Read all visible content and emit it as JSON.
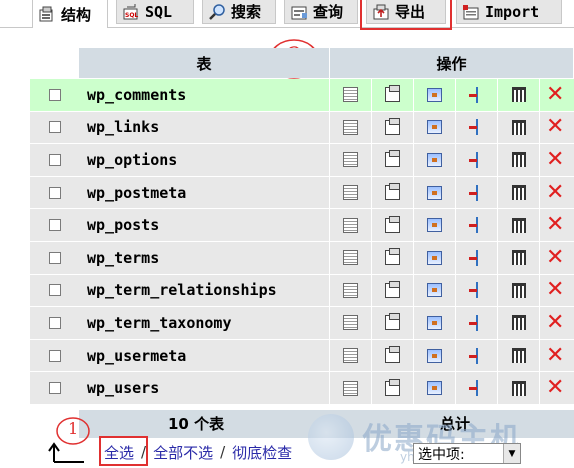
{
  "tabs": [
    {
      "label": "结构",
      "icon": "structure-icon",
      "active": true
    },
    {
      "label": "SQL",
      "icon": "sql-icon"
    },
    {
      "label": "搜索",
      "icon": "search-icon"
    },
    {
      "label": "查询",
      "icon": "query-icon"
    },
    {
      "label": "导出",
      "icon": "export-icon"
    },
    {
      "label": "Import",
      "icon": "import-icon"
    }
  ],
  "header": {
    "table_col": "表",
    "actions_col": "操作"
  },
  "annotations": {
    "circle_2": "2",
    "circle_1": "1"
  },
  "tables": [
    "wp_comments",
    "wp_links",
    "wp_options",
    "wp_postmeta",
    "wp_posts",
    "wp_terms",
    "wp_term_relationships",
    "wp_term_taxonomy",
    "wp_usermeta",
    "wp_users"
  ],
  "row_actions": [
    "browse-icon",
    "structure-icon",
    "search-icon",
    "insert-icon",
    "empty-icon",
    "drop-icon"
  ],
  "footer": {
    "count": "10 个表",
    "total": "总计",
    "select_all": "全选",
    "unselect_all": "全部不选",
    "check_overhead": "彻底检查",
    "with_selected": "选中项:",
    "separator": "/"
  },
  "watermark": {
    "text": "优惠码主机",
    "sub": "yhm....com"
  },
  "colors": {
    "header": "#d3dce3",
    "row": "#e8e8e8",
    "hover": "#ccffcc",
    "highlight": "#e03030",
    "drop": "#e02020"
  }
}
